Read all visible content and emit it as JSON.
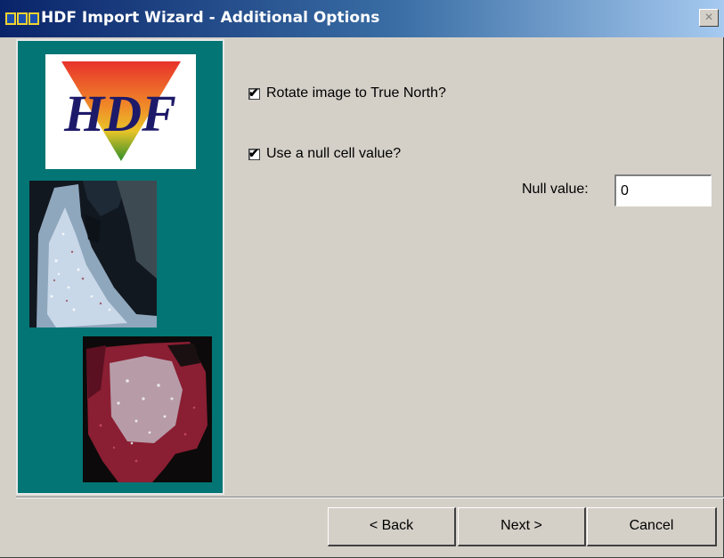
{
  "window": {
    "title": "HDF Import Wizard - Additional Options",
    "close_label": "×"
  },
  "side_panel": {
    "logo_text": "HDF"
  },
  "options": {
    "rotate": {
      "label": "Rotate image to True North?",
      "checked": true,
      "mark": "✔"
    },
    "null_cell": {
      "label": "Use a null cell value?",
      "checked": true,
      "mark": "✔"
    },
    "null_value": {
      "label": "Null value:",
      "value": "0"
    }
  },
  "buttons": {
    "back": "< Back",
    "next": "Next >",
    "cancel": "Cancel"
  },
  "colors": {
    "panel_bg": "#047575",
    "dialog_bg": "#d4d0c8",
    "title_start": "#0a246a",
    "title_end": "#a6caf0"
  }
}
